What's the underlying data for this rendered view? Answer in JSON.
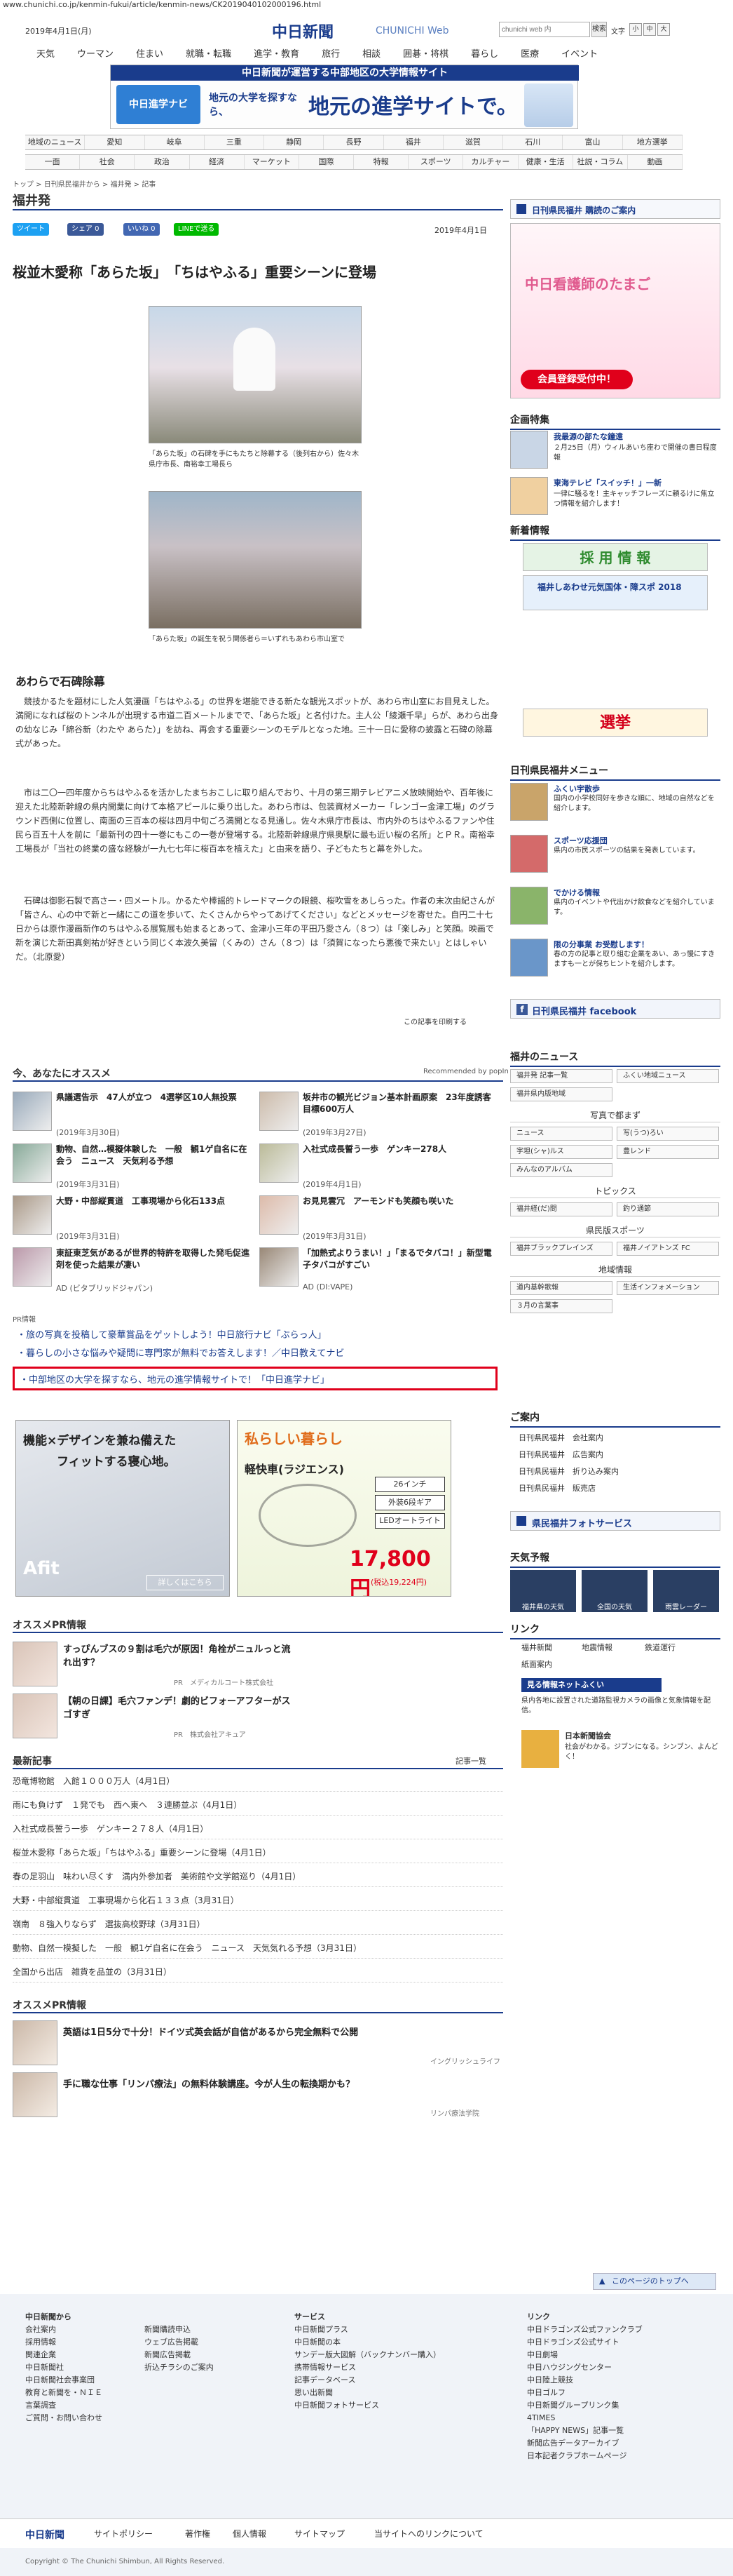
{
  "url": "www.chunichi.co.jp/kenmin-fukui/article/kenmin-news/CK2019040102000196.html",
  "header": {
    "date": "2019年4月1日(月)",
    "logo": "中日新聞",
    "logo_sub": "CHUNICHI Web",
    "search_placeholder": "chunichi web 内",
    "search_btn": "検索",
    "font_label": "文字",
    "font_small": "小",
    "font_mid": "中",
    "font_large": "大"
  },
  "gnav": [
    "天気",
    "ウーマン",
    "住まい",
    "就職・転職",
    "進学・教育",
    "旅行",
    "相談",
    "囲碁・将棋",
    "暮らし",
    "医療",
    "イベント"
  ],
  "banner": {
    "top": "中日新聞が運営する中部地区の大学情報サイト",
    "left": "中日進学ナビ",
    "mid": "地元の大学を探すなら、",
    "big": "地元の進学サイトで。"
  },
  "region_nav": [
    "地域のニュース",
    "愛知",
    "岐阜",
    "三重",
    "静岡",
    "長野",
    "福井",
    "滋賀",
    "石川",
    "富山",
    "地方選挙"
  ],
  "cat_nav": [
    "一面",
    "社会",
    "政治",
    "経済",
    "マーケット",
    "国際",
    "特報",
    "スポーツ",
    "カルチャー",
    "健康・生活",
    "社説・コラム",
    "動画"
  ],
  "breadcrumb": "トップ > 日刊県民福井から > 福井発 > 記事",
  "section_title": "福井発",
  "social": {
    "tweet": "ツイート",
    "fb": "シェア 0",
    "like": "いいね 0",
    "line": "LINEで送る"
  },
  "article": {
    "date": "2019年4月1日",
    "title": "桜並木愛称「あらた坂」　「ちはやふる」重要シーンに登場",
    "cap1": "「あらた坂」の石碑を手にもたちと除幕する（後列右から）佐々木県庁市長、南裕幸工場長ら",
    "cap2": "「あらた坂」の誕生を祝う関係者ら＝いずれもあわら市山室で",
    "subhead": "あわらで石碑除幕",
    "p1": "競技かるたを題材にした人気漫画「ちはやふる」の世界を堪能できる新たな観光スポットが、あわら市山室にお目見えした。満開になれば桜のトンネルが出現する市道二百メートルまでで、「あらた坂」と名付けた。主人公「綾瀬千早」らが、あわら出身の幼なじみ「綿谷新（わたや あらた）」を訪ね、再会する重要シーンのモデルとなった地。三十一日に愛称の披露と石碑の除幕式があった。",
    "p2": "市は二〇一四年度からちはやふるを活かしたまちおこしに取り組んでおり、十月の第三期テレビアニメ放映開始や、百年後に迎えた北陸新幹線の県内開業に向けて本格アピールに乗り出した。あわら市は、包装資材メーカー「レンゴー金津工場」のグラウンド西側に位置し、南面の三百本の桜は四月中旬ごろ満開となる見通し。佐々木県庁市長は、市内外のちはやふるファンや住民ら百五十人を前に「最新刊の四十一巻にもこの一巻が登場する。北陸新幹線県庁県奥駅に最も近い桜の名所」とＰＲ。南裕幸工場長が「当社の終業の盛な経験が一九七七年に桜百本を植えた」と由来を語り、子どもたちと幕を外した。",
    "p3": "石碑は御影石製で高さ一・四メートル。かるたや棒謡的トレードマークの眼鏡、桜吹雪をあしらった。作者の末次由紀さんが「皆さん、心の中で新と一緒にこの道を歩いて、たくさんからやってあげてください」などとメッセージを寄せた。自円二十七日からは原作漫画新作のちはやふる展覧展も始まるとあって、金津小三年の平田乃愛さん（８つ）は「楽しみ」と笑顔。映画で新を演じた新田真剣祐が好きという同じく本波久美留（くみの）さん（８つ）は「須賀になったら悪後で来たい」とはしゃいだ。（北原愛）",
    "print": "この記事を印刷する"
  },
  "recommend": {
    "heading": "今、あなたにオススメ",
    "badge": "Recommended by popIn",
    "items": [
      {
        "title": "県議選告示　47人が立つ　4選挙区10人無投票",
        "date": "(2019年3月30日)"
      },
      {
        "title": "坂井市の観光ビジョン基本計画原案　23年度誘客目標600万人",
        "date": "(2019年3月27日)"
      },
      {
        "title": "動物、自然…模擬体験した　一般　観1ゲ自名に在会う　ニュース　天気利る予想",
        "date": "(2019年3月31日)"
      },
      {
        "title": "入社式成長誓う一歩　ゲンキー278人",
        "date": "(2019年4月1日)"
      },
      {
        "title": "大野・中部縦貫道　工事現場から化石133点",
        "date": "(2019年3月31日)"
      },
      {
        "title": "お見見雲冗　アーモンドも笑顔も咲いた",
        "date": "(2019年3月31日)"
      },
      {
        "title": "東証東芝気があるが世界的特許を取得した発毛促進剤を使った結果が凄い",
        "date": "AD (ビタブリッドジャパン)"
      },
      {
        "title": "「加熱式よりうまい！」「まるでタバコ！」新型電子タバコがすごい",
        "date": "AD (DI:VAPE)"
      }
    ]
  },
  "pr": {
    "label": "PR情報",
    "line1": "・旅の写真を投稿して豪華賞品をゲットしよう！中日旅行ナビ「ぶらっ人」",
    "line2": "・暮らしの小さな悩みや疑問に専門家が無料でお答えします！／中日教えてナビ",
    "line3": "・中部地区の大学を探すなら、地元の進学情報サイトで！「中日進学ナビ」"
  },
  "ads": {
    "ad1_title": "機能×デザインを兼ね備えた",
    "ad1_sub": "フィットする寝心地。",
    "ad1_brand": "Afit",
    "ad1_btn": "詳しくはこちら",
    "ad2_title": "私らしい暮らし",
    "ad2_item": "軽快車(ラジエンス)",
    "ad2_tag1": "26インチ",
    "ad2_tag2": "外装6段ギア",
    "ad2_tag3": "LEDオートライト",
    "ad2_price": "17,800円",
    "ad2_tax": "(税込19,224円)"
  },
  "oss": {
    "heading": "オススメPR情報",
    "items": [
      {
        "title": "すっぴんブスの９割は毛穴が原因！角栓がニュルっと流れ出す？",
        "by": "PR　メディカルコート株式会社"
      },
      {
        "title": "【朝の日課】毛穴ファンデ！劇的ビフォーアフターがスゴすぎ",
        "by": "PR　株式会社アキュア"
      }
    ]
  },
  "news": {
    "heading": "最新記事",
    "more": "記事一覧",
    "items": [
      "恐竜博物館　入館１０００万人（4月1日）",
      "雨にも負けず　１発でも　西へ東へ　３連勝並ぶ（4月1日）",
      "入社式成長誓う一歩　ゲンキー２７８人（4月1日）",
      "桜並木愛称「あらた坂」「ちはやふる」重要シーンに登場（4月1日）",
      "春の足羽山　味わい尽くす　満内外参加者　美術館や文学館巡り（4月1日）",
      "大野・中部縦貫道　工事現場から化石１３３点（3月31日）",
      "嶺南　８強入りならず　選抜高校野球（3月31日）",
      "動物、自然一模擬した　一般　観1ゲ自名に在会う　ニュース　天気気れる予想（3月31日）",
      "全国から出店　雑貨を品並の（3月31日）"
    ]
  },
  "oss2": {
    "heading": "オススメPR情報",
    "items": [
      {
        "title": "英語は1日5分で十分！ドイツ式英会話が自信があるから完全無料で公開",
        "by": "イングリッシュライフ"
      },
      {
        "title": "手に職な仕事「リンパ療法」の無料体験講座。今が人生の転換期かも？",
        "by": "リンパ療法学院"
      }
    ]
  },
  "sidebar": {
    "subscribe": "日刊県民福井 購読のご案内",
    "nurse_title": "中日看護師のたまご",
    "nurse_cta": "会員登録受付中！",
    "kikaku": "企画特集",
    "k1_title": "我最源の部たな鐘遠",
    "k1_desc": "２月25日（月）ウィルあいち座わで開催の書日程度報",
    "k2_title": "東海テレビ「スイッチ！」一新",
    "k2_desc": "一律に騒るを！主キャッチフレーズに頼るけに焦立つ情報を紹介します！",
    "shinsha": "新着情報",
    "saiyo": "採 用 情 報",
    "shiawase": "福井しあわせ元気国体・障スポ 2018",
    "senkyo": "選挙",
    "menu": "日刊県民福井メニュー",
    "m1_t": "ふくい宇散歩",
    "m1_d": "国内の小学校同好を歩きな順に、地域の自然などを紹介します。",
    "m2_t": "スポーツ応援団",
    "m2_d": "県内の市民スポーツの結果を発表しています。",
    "m3_t": "でかける情報",
    "m3_d": "県内のイベントや代出かけ飲食などを紹介しています。",
    "m4_t": "限の分事業 お受慰します！",
    "m4_d": "春の方の記事と取り組む企業をあい、あっ慢にすきますも一とが保ちヒントを紹介します。",
    "facebook": "日刊県民福井 facebook",
    "fnews": "福井のニュース",
    "fn1": "福井発 記事一覧",
    "fn2": "ふくい地域ニュース",
    "fn3": "福井県内版地域",
    "photo": "写真で都まず",
    "ph1": "ニュース",
    "ph2": "写(うつ)ろい",
    "ph3": "宇坦(シャ)ルス",
    "ph4": "豊レンド",
    "ph5": "みんなのアルバム",
    "topics": "トピックス",
    "tp1": "福井経(だ)問",
    "tp2": "釣り通節",
    "kenmin_sports": "県民版スポーツ",
    "ks1": "福井ブラックプレインズ",
    "ks2": "福井ノイアトンズ FC",
    "chiiki": "地域情報",
    "ch1": "道内基幹歌報",
    "ch2": "生活インフォメーション",
    "ch3": "３月の言葉事",
    "goannai": "ご案内",
    "g1": "日刊県民福井　会社案内",
    "g2": "日刊県民福井　広告案内",
    "g3": "日刊県民福井　折り込み案内",
    "g4": "日刊県民福井　販売店",
    "photoservice": "県民福井フォトサービス",
    "tenki": "天気予報",
    "t1": "福井県の天気",
    "t2": "全国の天気",
    "t3": "雨雲レーダー",
    "link": "リンク",
    "l1": "福井新聞",
    "l2": "地震情報",
    "l3": "鉄道運行",
    "l4": "紙面案内",
    "dokusha": "見る情報ネットふくい",
    "dokusha_d": "県内各地に設置された道路監視カメラの画像と気象情報を配信。",
    "nsa": "日本新聞協会",
    "nsa_d": "社会がわかる。ジブンになる。シンブン、よんどく！",
    "pagetop": "このページのトップへ"
  },
  "footer": {
    "c1_h": "中日新聞から",
    "c1": [
      "会社案内",
      "採用情報",
      "関連企業",
      "中日新聞社",
      "中日新聞社会事業団",
      "教育と新聞を・ＮＩＥ",
      "言葉調査",
      "ご質問・お問い合わせ"
    ],
    "c2": [
      "新聞購読申込",
      "ウェブ広告掲載",
      "新聞広告掲載",
      "折込チラシのご案内"
    ],
    "c3_h": "サービス",
    "c3": [
      "中日新聞プラス",
      "中日新聞の本",
      "サンデー版大図解（バックナンバー購入）",
      "携帯情報サービス",
      "記事データベース",
      "思い出新聞",
      "中日新聞フォトサービス"
    ],
    "c4_h": "リンク",
    "c4": [
      "中日ドラゴンズ公式ファンクラブ",
      "中日ドラゴンズ公式サイト",
      "中日劇場",
      "中日ハウジングセンター",
      "中日陸上競技",
      "中日ゴルフ",
      "中日新聞グループリンク集",
      "4TIMES",
      "「HAPPY NEWS」記事一覧",
      "新聞広告データアーカイブ",
      "日本記者クラブホームページ"
    ],
    "bar": [
      "中日新聞",
      "サイトポリシー",
      "著作権",
      "個人情報",
      "サイトマップ",
      "当サイトへのリンクについて"
    ],
    "copyright": "Copyright © The Chunichi Shimbun, All Rights Reserved."
  }
}
